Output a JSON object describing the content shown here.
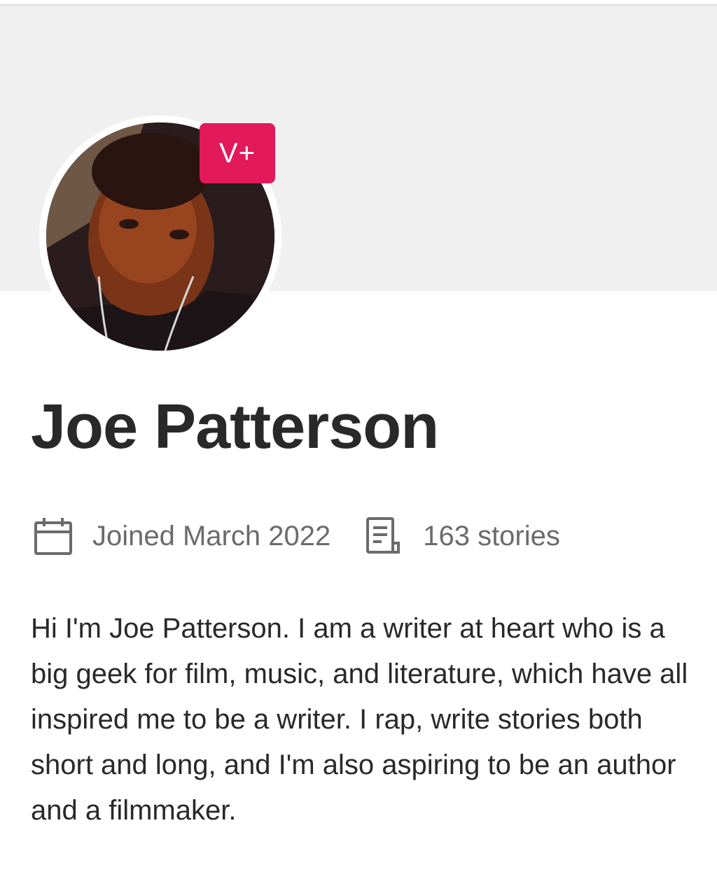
{
  "profile": {
    "badge": "V+",
    "name": "Joe Patterson",
    "joined": "Joined March 2022",
    "stories": "163 stories",
    "bio": "Hi I'm Joe Patterson. I am a writer at heart who is a big geek for film, music, and literature, which have all inspired me to be a writer. I rap, write stories both short and long, and I'm also aspiring to be an author and a filmmaker."
  },
  "icons": {
    "joined": "calendar-icon",
    "stories": "document-icon"
  },
  "colors": {
    "badge_bg": "#e2195b",
    "cover_bg": "#f0f0f0",
    "text_primary": "#292929",
    "text_secondary": "#6b6b6b"
  }
}
